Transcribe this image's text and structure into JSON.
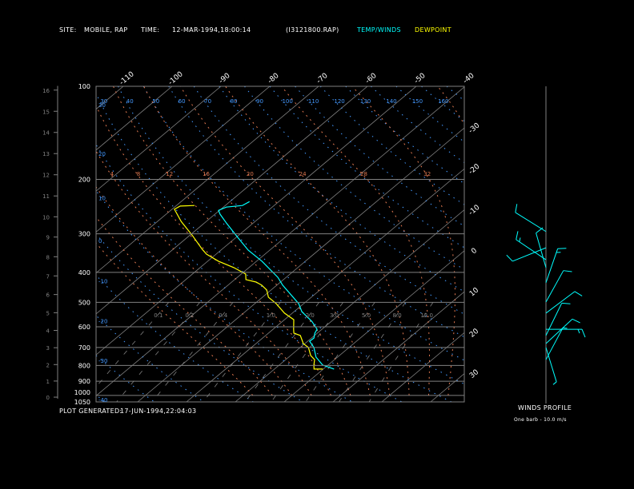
{
  "header": {
    "site_label": "SITE:",
    "site": "MOBILE, RAP",
    "time_label": "TIME:",
    "time": "12-MAR-1994,18:00:14",
    "file": "(I3121800.RAP)",
    "legend_temp": "TEMP/WINDS",
    "legend_dewpoint": "DEWPOINT"
  },
  "footer": {
    "generated_label": "PLOT GENERATED:",
    "generated": "17-JUN-1994,22:04:03"
  },
  "winds_panel": {
    "title": "WINDS PROFILE",
    "note": "One barb - 10.0 m/s"
  },
  "colors": {
    "background": "#000000",
    "temperature": "#00ffff",
    "dewpoint": "#ffff00",
    "dry_adiabat": "#4499ff",
    "moist_adiabat": "#e07850",
    "grid": "#808080",
    "text": "#ffffff"
  },
  "chart_data": {
    "type": "line",
    "subtype": "skew-t log-p",
    "y_axis_pressure_hpa": [
      100,
      200,
      300,
      400,
      500,
      600,
      700,
      800,
      900,
      1000,
      1050
    ],
    "ylim_hpa": [
      1050,
      100
    ],
    "y_scale": "log",
    "altitude_axis_km": [
      0,
      1,
      2,
      3,
      4,
      5,
      6,
      7,
      8,
      9,
      10,
      11,
      12,
      13,
      14,
      15,
      16
    ],
    "isotherm_labels_top": [
      -110,
      -100,
      -90,
      -80,
      -70,
      -60,
      -50,
      -40
    ],
    "isotherm_labels_right": [
      -30,
      -20,
      -10,
      0,
      10,
      20,
      30
    ],
    "dry_adiabat_labels_top": [
      30,
      40,
      50,
      60,
      70,
      80,
      90,
      100,
      110,
      120,
      130,
      140,
      150,
      160
    ],
    "dry_adiabat_labels_left": [
      30,
      20,
      10,
      0,
      -10,
      -20,
      -30,
      -40
    ],
    "moist_adiabat_labels": [
      4,
      8,
      12,
      16,
      20,
      24,
      28,
      32
    ],
    "mixing_ratio_labels": [
      "0.1",
      "0.2",
      "0.4",
      "1.0",
      "2.0",
      "3.0",
      "5.0",
      "8.0",
      "12.0"
    ],
    "grid": true,
    "series": [
      {
        "name": "TEMP/WINDS",
        "points": [
          [
            822,
            2.2
          ],
          [
            798,
            -1.1
          ],
          [
            752,
            -4.4
          ],
          [
            700,
            -7.2
          ],
          [
            668,
            -9.6
          ],
          [
            652,
            -9.5
          ],
          [
            629,
            -10.5
          ],
          [
            611,
            -11.0
          ],
          [
            576,
            -14.0
          ],
          [
            536,
            -18.4
          ],
          [
            505,
            -21.0
          ],
          [
            440,
            -28.8
          ],
          [
            415,
            -31.7
          ],
          [
            368,
            -38.9
          ],
          [
            339,
            -44.4
          ],
          [
            308,
            -49.7
          ],
          [
            278,
            -55.3
          ],
          [
            259,
            -59.0
          ],
          [
            252,
            -60.2
          ],
          [
            246,
            -59.4
          ],
          [
            243,
            -56.5
          ],
          [
            236,
            -56.0
          ]
        ]
      },
      {
        "name": "DEWPOINT",
        "points": [
          [
            822,
            -0.1
          ],
          [
            822,
            -1.9
          ],
          [
            798,
            -2.9
          ],
          [
            766,
            -4.1
          ],
          [
            743,
            -5.9
          ],
          [
            700,
            -8.3
          ],
          [
            680,
            -10.3
          ],
          [
            640,
            -12.9
          ],
          [
            629,
            -14.8
          ],
          [
            611,
            -15.8
          ],
          [
            569,
            -18.1
          ],
          [
            542,
            -21.6
          ],
          [
            505,
            -25.6
          ],
          [
            481,
            -28.8
          ],
          [
            456,
            -30.9
          ],
          [
            440,
            -33.1
          ],
          [
            430,
            -35.0
          ],
          [
            422,
            -37.7
          ],
          [
            405,
            -39.1
          ],
          [
            386,
            -43.1
          ],
          [
            368,
            -47.8
          ],
          [
            349,
            -52.0
          ],
          [
            337,
            -54.0
          ],
          [
            304,
            -59.4
          ],
          [
            274,
            -65.1
          ],
          [
            250,
            -69.5
          ],
          [
            244,
            -69.1
          ],
          [
            243,
            -66.3
          ]
        ]
      }
    ],
    "winds": [
      {
        "pressure": 295,
        "direction": 302,
        "speed": 10
      },
      {
        "pressure": 333,
        "direction": 248,
        "speed": 10
      },
      {
        "pressure": 364,
        "direction": 304,
        "speed": 15
      },
      {
        "pressure": 386,
        "direction": 344,
        "speed": 10
      },
      {
        "pressure": 432,
        "direction": 19,
        "speed": 15
      },
      {
        "pressure": 499,
        "direction": 29,
        "speed": 10
      },
      {
        "pressure": 542,
        "direction": 53,
        "speed": 10
      },
      {
        "pressure": 611,
        "direction": 90,
        "speed": 15
      },
      {
        "pressure": 640,
        "direction": 26,
        "speed": 10
      },
      {
        "pressure": 680,
        "direction": 47,
        "speed": 10
      },
      {
        "pressure": 700,
        "direction": 163,
        "speed": 5
      },
      {
        "pressure": 766,
        "direction": 28,
        "speed": 5
      }
    ]
  }
}
